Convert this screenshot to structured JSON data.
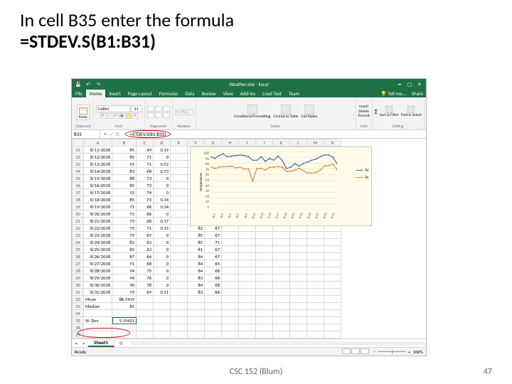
{
  "slide": {
    "title_line1": "In cell B35 enter the formula",
    "title_line2": "=STDEV.S(B1:B31)",
    "footer_center": "CSC 152 (Blum)",
    "footer_right": "47"
  },
  "excel": {
    "title": "Weather.xlsx - Excel",
    "tell_me": "Tell me...",
    "share": "Share",
    "ribbon_tabs": [
      "File",
      "Home",
      "Insert",
      "Page Layout",
      "Formulas",
      "Data",
      "Review",
      "View",
      "Add-ins",
      "Load Test",
      "Team"
    ],
    "groups": {
      "clipboard": "Clipboard",
      "font": "Font",
      "alignment": "Alignment",
      "number": "Number",
      "styles": "Styles",
      "cells": "Cells",
      "editing": "Editing"
    },
    "paste_label": "Paste",
    "font_name": "Calibri",
    "font_size": "11",
    "style_labels": {
      "cond": "Conditional\nFormatting",
      "table": "Format as\nTable",
      "cell": "Cell\nStyles"
    },
    "cell_labels": {
      "ins": "Insert",
      "del": "Delete",
      "fmt": "Format"
    },
    "edit_labels": {
      "sort": "Sort &\nFilter",
      "find": "Find &\nSelect"
    },
    "name_box": "B35",
    "formula": "=STDEV.S(B1:B31)",
    "status_left": "Ready",
    "zoom": "100%",
    "sheet_tab": "Sheet1",
    "columns": [
      "",
      "A",
      "B",
      "C",
      "D",
      "E",
      "F",
      "G",
      "H",
      "I",
      "J",
      "K",
      "L",
      "M",
      "N"
    ],
    "rows_top": [
      {
        "n": "11",
        "a": "8/11/2018",
        "b": "85",
        "c": "49",
        "d": "0.19"
      },
      {
        "n": "12",
        "a": "8/12/2018",
        "b": "85",
        "c": "71",
        "d": "0"
      },
      {
        "n": "13",
        "a": "8/13/2018",
        "b": "91",
        "c": "71",
        "d": "0.52"
      },
      {
        "n": "14",
        "a": "8/14/2018",
        "b": "83",
        "c": "68",
        "d": "0.73"
      },
      {
        "n": "15",
        "a": "8/15/2018",
        "b": "88",
        "c": "73",
        "d": "0"
      },
      {
        "n": "16",
        "a": "8/16/2018",
        "b": "85",
        "c": "73",
        "d": "0"
      },
      {
        "n": "17",
        "a": "8/17/2018",
        "b": "92",
        "c": "74",
        "d": "0"
      },
      {
        "n": "18",
        "a": "8/18/2018",
        "b": "85",
        "c": "73",
        "d": "0.34"
      },
      {
        "n": "19",
        "a": "8/19/2018",
        "b": "71",
        "c": "66",
        "d": "0.34"
      },
      {
        "n": "20",
        "a": "8/20/2018",
        "b": "73",
        "c": "66",
        "d": "0"
      },
      {
        "n": "21",
        "a": "8/21/2018",
        "b": "79",
        "c": "68",
        "d": "0.17"
      }
    ],
    "rows_bottom": [
      {
        "n": "22",
        "a": "8/22/2018",
        "b": "75",
        "c": "71",
        "d": "0.15",
        "f": "82",
        "g": "67"
      },
      {
        "n": "23",
        "a": "8/23/2018",
        "b": "79",
        "c": "67",
        "d": "0",
        "f": "85",
        "g": "67"
      },
      {
        "n": "24",
        "a": "8/24/2018",
        "b": "82",
        "c": "63",
        "d": "0",
        "f": "85",
        "g": "71"
      },
      {
        "n": "25",
        "a": "8/25/2018",
        "b": "85",
        "c": "63",
        "d": "0",
        "f": "81",
        "g": "67"
      },
      {
        "n": "26",
        "a": "8/26/2018",
        "b": "87",
        "c": "64",
        "d": "0",
        "f": "84",
        "g": "67"
      },
      {
        "n": "27",
        "a": "8/27/2018",
        "b": "91",
        "c": "68",
        "d": "0",
        "f": "84",
        "g": "65"
      },
      {
        "n": "28",
        "a": "8/28/2018",
        "b": "94",
        "c": "75",
        "d": "0",
        "f": "84",
        "g": "66"
      },
      {
        "n": "29",
        "a": "8/29/2018",
        "b": "94",
        "c": "76",
        "d": "0",
        "f": "83",
        "g": "66"
      },
      {
        "n": "30",
        "a": "8/30/2018",
        "b": "90",
        "c": "78",
        "d": "0",
        "f": "84",
        "g": "68"
      },
      {
        "n": "31",
        "a": "8/31/2018",
        "b": "79",
        "c": "69",
        "d": "0.11",
        "f": "83",
        "g": "66"
      }
    ],
    "summary": [
      {
        "n": "32",
        "a": "Mean",
        "b": "86.7419"
      },
      {
        "n": "33",
        "a": "Median",
        "b": "85"
      },
      {
        "n": "34",
        "a": ""
      },
      {
        "n": "35",
        "a": "St. Dev",
        "b": "5.19421"
      },
      {
        "n": "36",
        "a": ""
      },
      {
        "n": "37",
        "a": ""
      }
    ]
  },
  "chart_data": {
    "type": "line",
    "ylim": [
      0,
      100
    ],
    "yticks": [
      "100",
      "90",
      "80",
      "70",
      "60",
      "50",
      "40",
      "30",
      "20",
      "10",
      "0"
    ],
    "ylabel": "temperature",
    "categories": [
      "8/1",
      "8/3",
      "8/5",
      "8/7",
      "8/9",
      "8/11",
      "8/13",
      "8/15",
      "8/17",
      "8/19",
      "8/21",
      "8/23",
      "8/25",
      "8/27",
      "8/29",
      "8/31"
    ],
    "series": [
      {
        "name": "hi",
        "color": "#3b6fb6",
        "values": [
          91,
          88,
          93,
          96,
          91,
          92,
          93,
          94,
          93,
          91,
          85,
          85,
          91,
          83,
          88,
          85,
          92,
          85,
          71,
          73,
          79,
          75,
          79,
          82,
          85,
          87,
          91,
          94,
          94,
          90,
          79
        ]
      },
      {
        "name": "lo",
        "color": "#d88a3f",
        "values": [
          74,
          71,
          73,
          74,
          74,
          75,
          72,
          73,
          70,
          70,
          49,
          71,
          71,
          68,
          73,
          73,
          74,
          73,
          66,
          66,
          68,
          71,
          67,
          63,
          63,
          64,
          68,
          75,
          76,
          78,
          69
        ]
      }
    ]
  }
}
